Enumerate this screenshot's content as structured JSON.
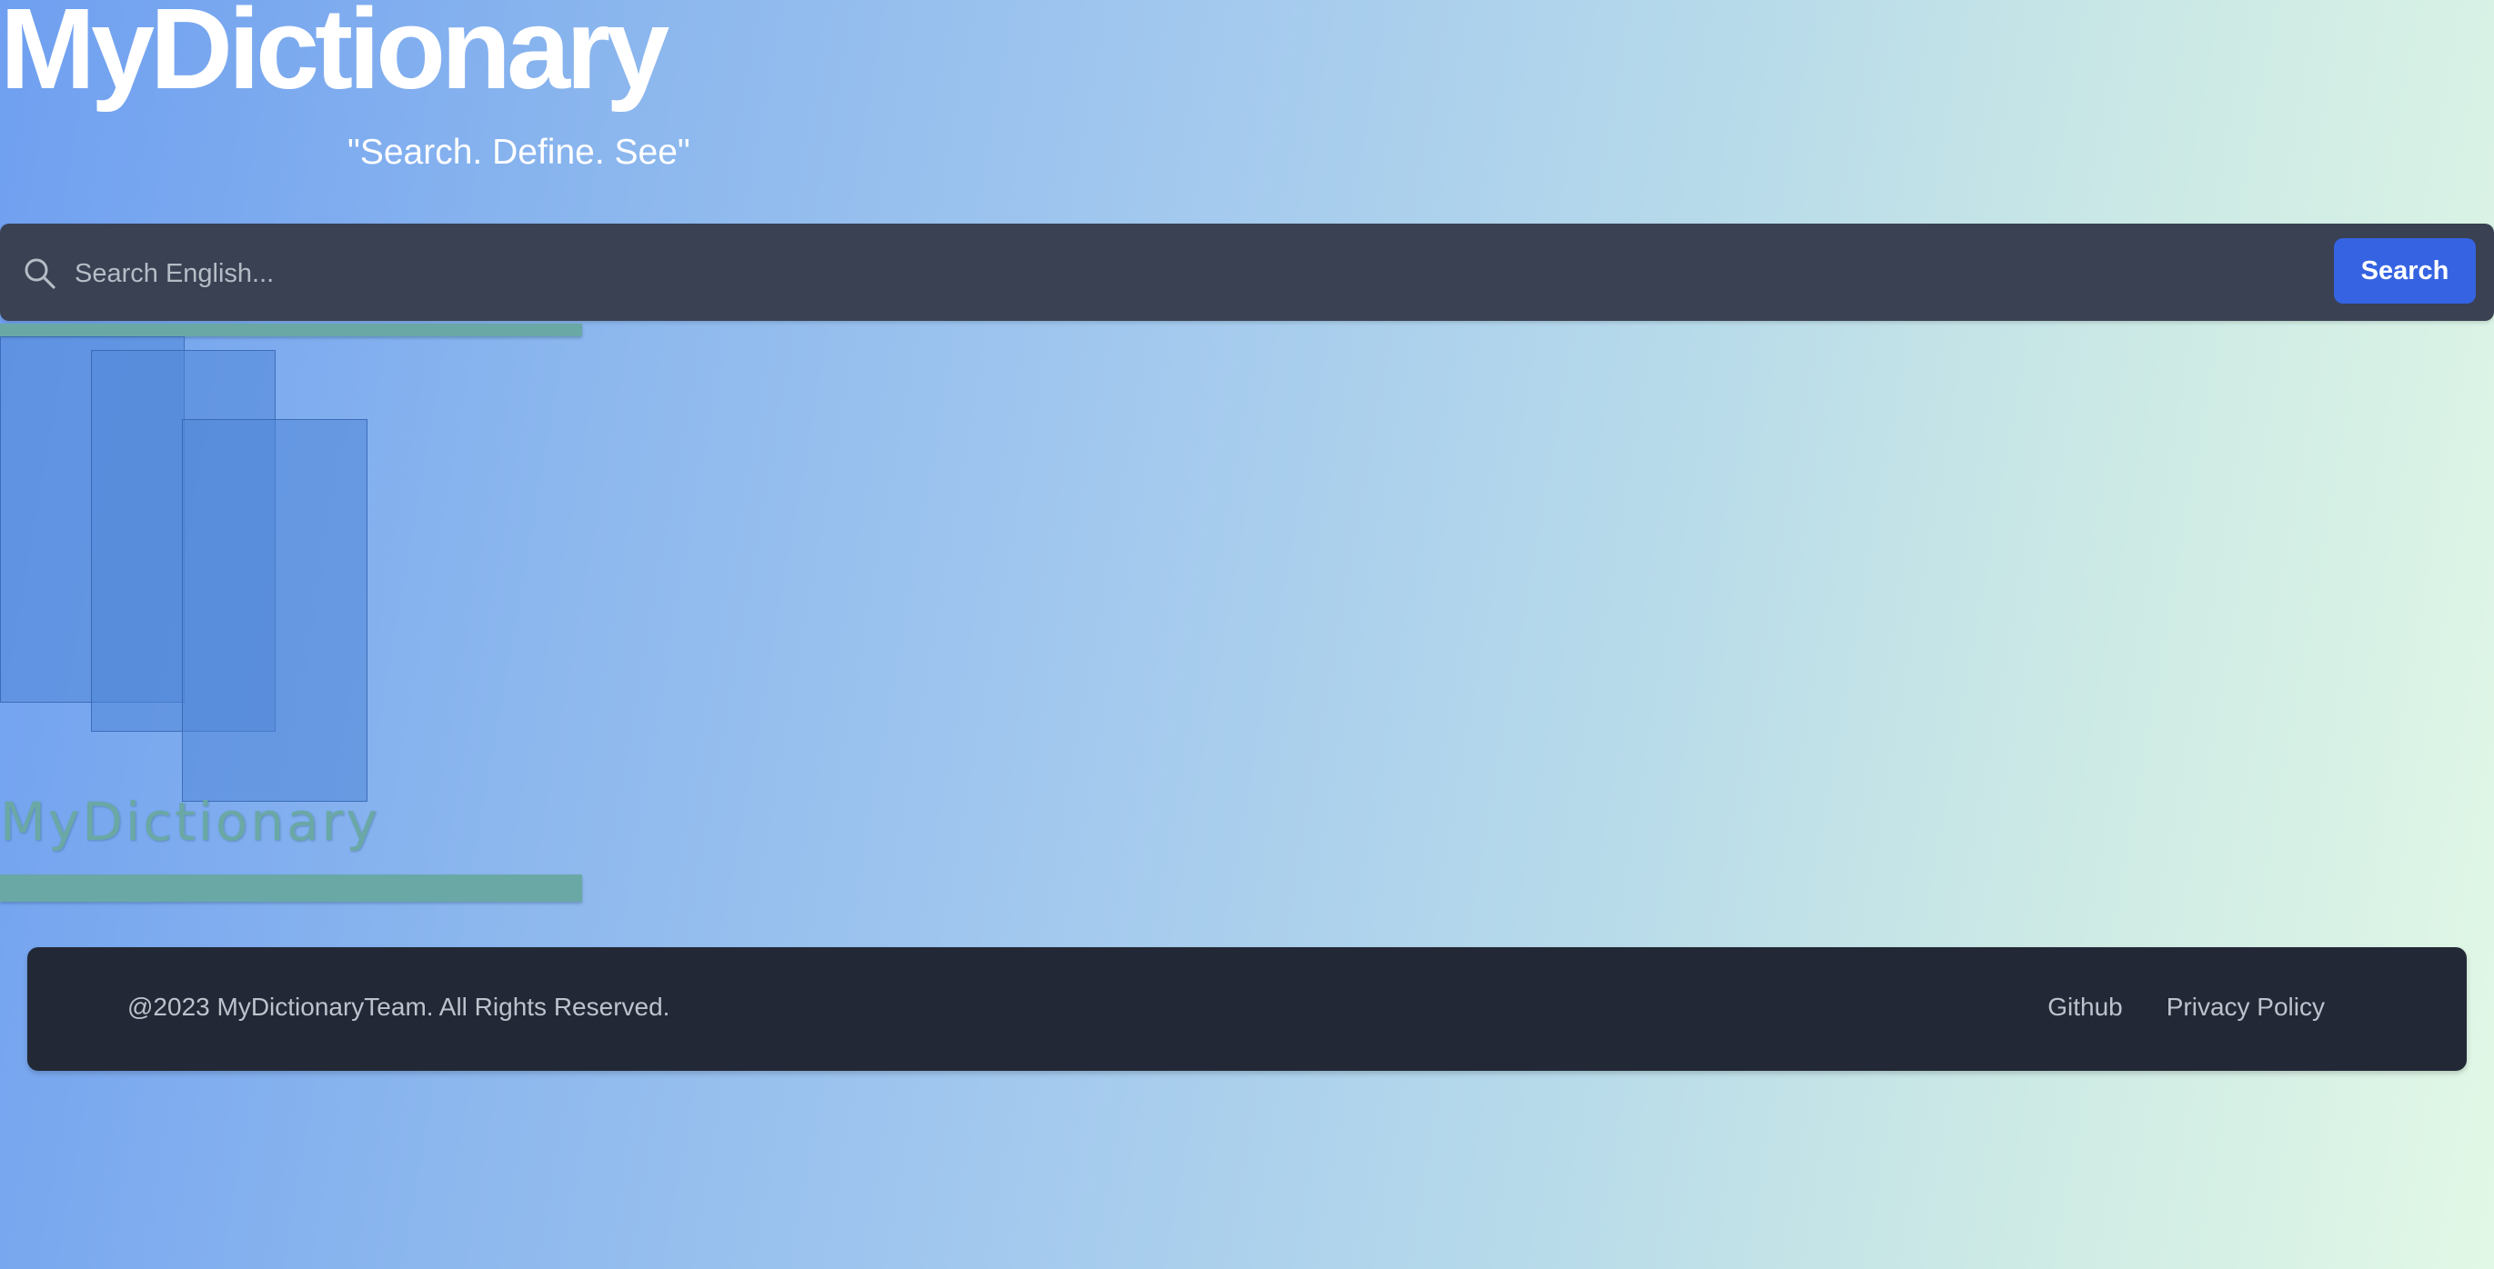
{
  "header": {
    "title": "MyDictionary",
    "tagline": "\"Search. Define. See\""
  },
  "search": {
    "placeholder": "Search English...",
    "value": "",
    "button_label": "Search",
    "icon": "search-icon",
    "bar_color": "#394152",
    "button_color": "#3563e2"
  },
  "logo": {
    "text": "MyDictionary",
    "accent_color": "#6aa8a6"
  },
  "footer": {
    "copyright": "@2023 MyDictionaryTeam. All Rights Reserved.",
    "links": [
      {
        "label": "Github"
      },
      {
        "label": "Privacy Policy"
      }
    ],
    "background_color": "#222835"
  }
}
